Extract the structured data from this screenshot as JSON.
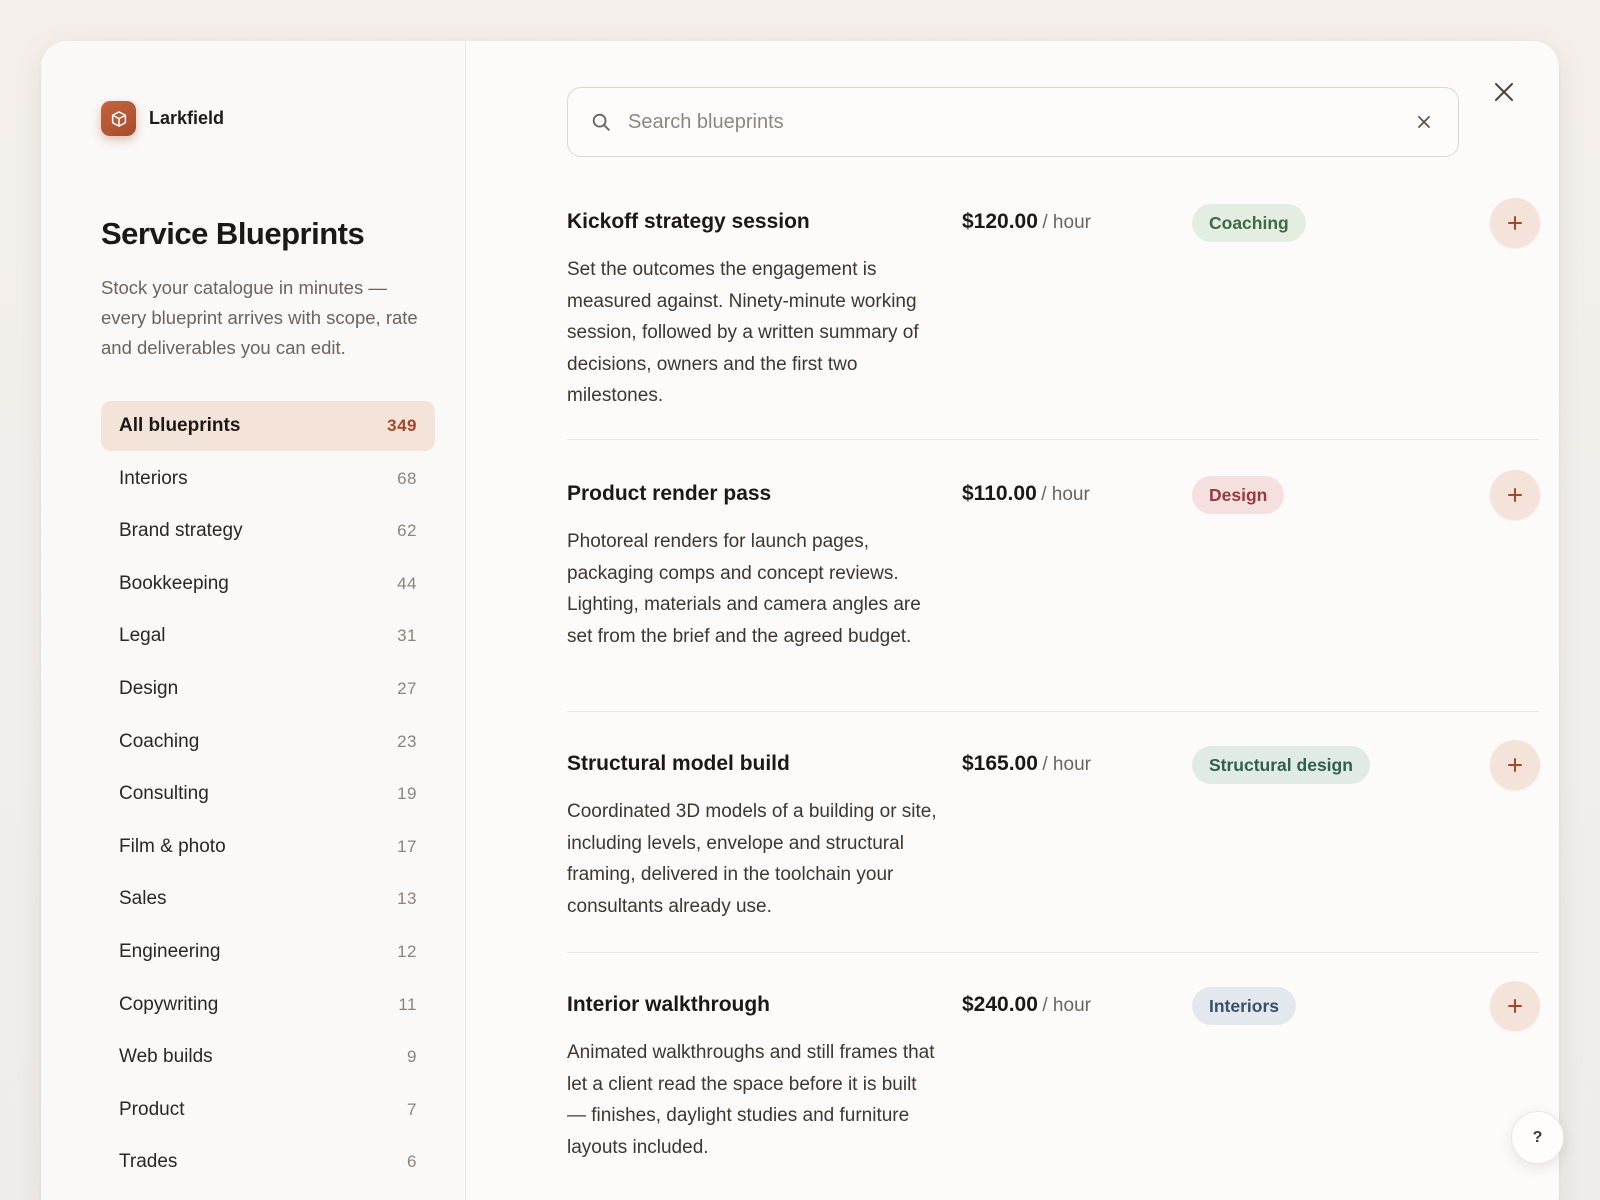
{
  "brand": {
    "name": "Larkfield",
    "logo_icon": "cube-icon",
    "accent": "#b0532f"
  },
  "page": {
    "title": "Service Blueprints",
    "description": "Stock your catalogue in minutes — every blueprint arrives with scope, rate and deliverables you can edit."
  },
  "categories": [
    {
      "label": "All blueprints",
      "count": "349",
      "active": true
    },
    {
      "label": "Interiors",
      "count": "68"
    },
    {
      "label": "Brand strategy",
      "count": "62"
    },
    {
      "label": "Bookkeeping",
      "count": "44"
    },
    {
      "label": "Legal",
      "count": "31"
    },
    {
      "label": "Design",
      "count": "27"
    },
    {
      "label": "Coaching",
      "count": "23"
    },
    {
      "label": "Consulting",
      "count": "19"
    },
    {
      "label": "Film & photo",
      "count": "17"
    },
    {
      "label": "Sales",
      "count": "13"
    },
    {
      "label": "Engineering",
      "count": "12"
    },
    {
      "label": "Copywriting",
      "count": "11"
    },
    {
      "label": "Web builds",
      "count": "9"
    },
    {
      "label": "Product",
      "count": "7"
    },
    {
      "label": "Trades",
      "count": "6"
    }
  ],
  "search": {
    "placeholder": "Search blueprints",
    "value": "",
    "icon": "search-icon",
    "clear_icon": "clear-icon"
  },
  "close_icon": "close-icon",
  "blueprints": [
    {
      "title": "Kickoff strategy session",
      "description": "Set the outcomes the engagement is measured against. Ninety-minute working session, followed by a written summary of decisions, owners and the first two milestones.",
      "price": "$120.00",
      "unit": "/ hour",
      "tag": "Coaching",
      "tag_bg": "#e3ede1",
      "tag_color": "#3e6a45"
    },
    {
      "title": "Product render pass",
      "description": "Photoreal renders for launch pages, packaging comps and concept reviews. Lighting, materials and camera angles are set from the brief and the agreed budget.",
      "price": "$110.00",
      "unit": "/ hour",
      "tag": "Design",
      "tag_bg": "#f5e0e0",
      "tag_color": "#9a3a3d"
    },
    {
      "title": "Structural model build",
      "description": "Coordinated 3D models of a building or site, including levels, envelope and structural framing, delivered in the toolchain your consultants already use.",
      "price": "$165.00",
      "unit": "/ hour",
      "tag": "Structural design",
      "tag_bg": "#e0ebe6",
      "tag_color": "#2f5f4f"
    },
    {
      "title": "Interior walkthrough",
      "description": "Animated walkthroughs and still frames that let a client read the space before it is built — finishes, daylight studies and furniture layouts included.",
      "price": "$240.00",
      "unit": "/ hour",
      "tag": "Interiors",
      "tag_bg": "#e3e8ef",
      "tag_color": "#3c4e68"
    }
  ],
  "add_icon": "plus-icon",
  "help": {
    "label": "?"
  }
}
